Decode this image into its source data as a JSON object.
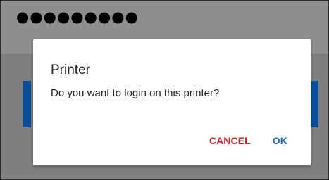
{
  "header": {
    "password_mask": "●●●●●●●●●"
  },
  "dialog": {
    "title": "Printer",
    "message": "Do you want to login on this printer?",
    "buttons": {
      "cancel": "CANCEL",
      "ok": "OK"
    }
  },
  "colors": {
    "overlay_background": "#7f7f7f",
    "top_bar_background": "#8e8e8e",
    "accent_blue": "#0a4f99",
    "dialog_background": "#ffffff",
    "cancel_text": "#c62828",
    "ok_text": "#1565c0"
  }
}
